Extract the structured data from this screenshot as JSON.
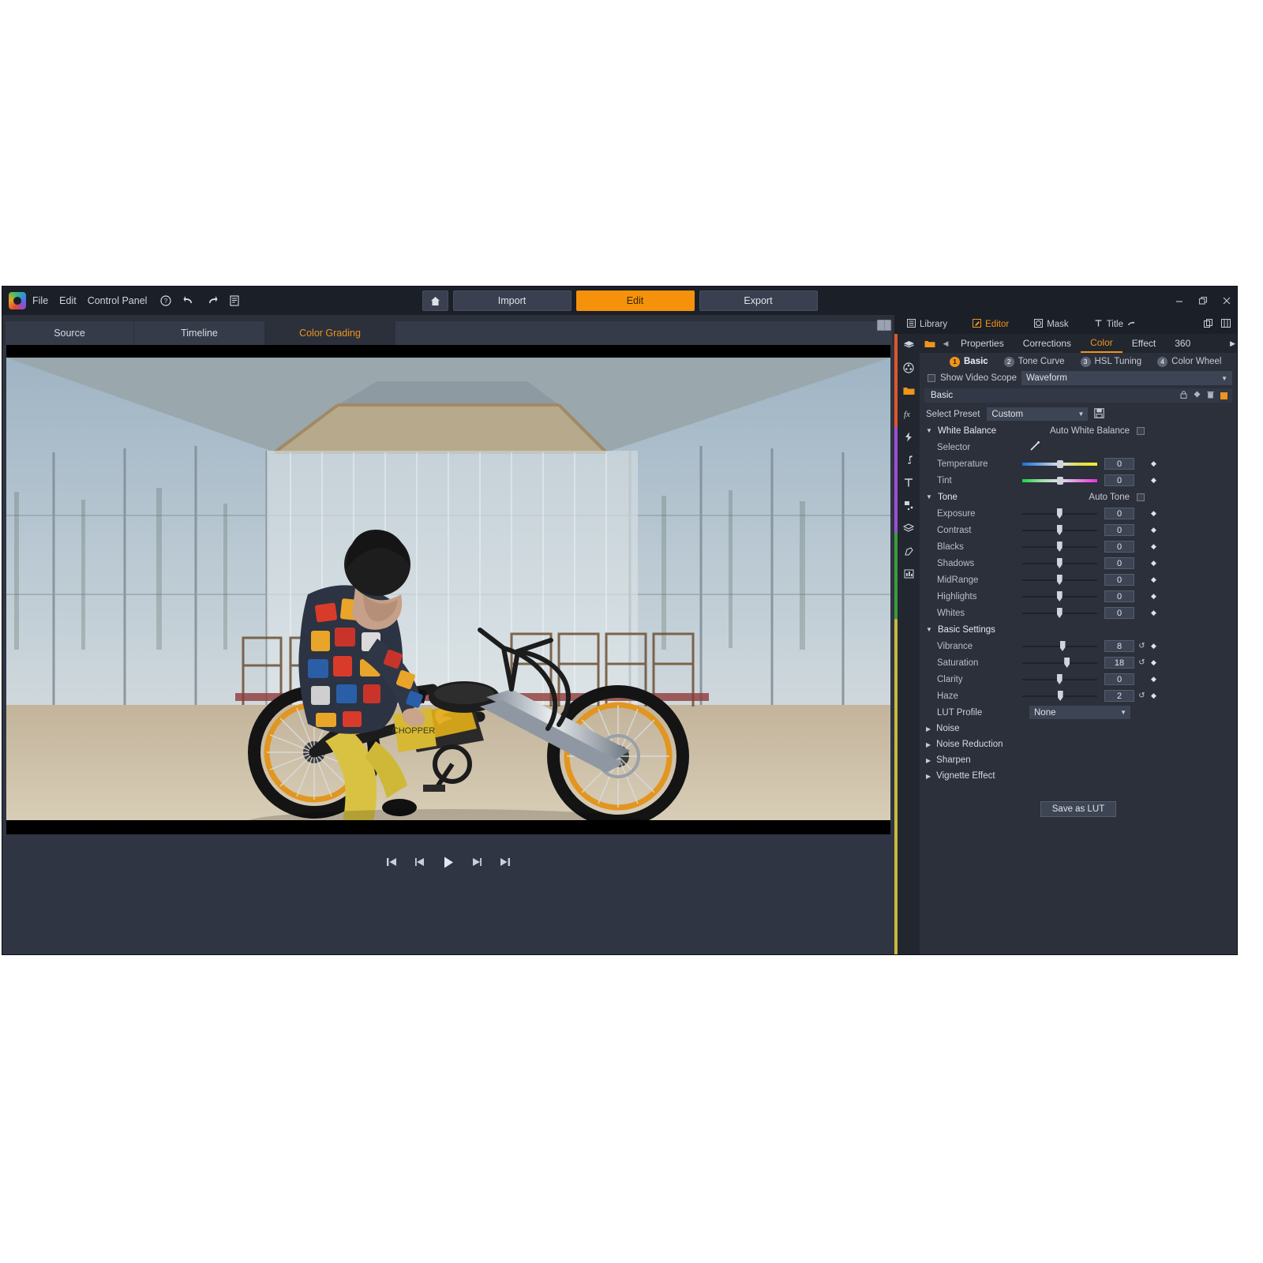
{
  "window": {
    "menu": [
      "File",
      "Edit",
      "Control Panel"
    ],
    "toolbar_icons": [
      "help-icon",
      "undo-icon",
      "redo-icon",
      "document-icon"
    ],
    "controls": [
      "minimize",
      "restore",
      "close"
    ],
    "mode_buttons": [
      {
        "label": "Import",
        "active": false
      },
      {
        "label": "Edit",
        "active": true
      },
      {
        "label": "Export",
        "active": false
      }
    ],
    "home_icon": "home-icon"
  },
  "preview": {
    "tabs": [
      "Source",
      "Timeline",
      "Color Grading"
    ],
    "active_tab": "Color Grading",
    "transport": [
      "skip-to-start",
      "step-back",
      "play",
      "step-forward",
      "skip-to-end"
    ]
  },
  "right_panel": {
    "top_tabs": [
      {
        "label": "Library",
        "icon": "library-icon",
        "active": false
      },
      {
        "label": "Editor",
        "icon": "editor-pencil-icon",
        "active": true
      },
      {
        "label": "Mask",
        "icon": "mask-icon",
        "active": false
      },
      {
        "label": "Title",
        "icon": "title-T-icon",
        "active": false
      }
    ],
    "mode_tabs": [
      {
        "label": "Properties",
        "active": false
      },
      {
        "label": "Corrections",
        "active": false
      },
      {
        "label": "Color",
        "active": true
      },
      {
        "label": "Effect",
        "active": false
      },
      {
        "label": "360",
        "active": false
      }
    ],
    "numbered_tabs": [
      {
        "num": "1",
        "label": "Basic",
        "active": true
      },
      {
        "num": "2",
        "label": "Tone Curve",
        "active": false
      },
      {
        "num": "3",
        "label": "HSL Tuning",
        "active": false
      },
      {
        "num": "4",
        "label": "Color Wheel",
        "active": false
      }
    ],
    "video_scope": {
      "checkbox_label": "Show Video Scope",
      "checked": false,
      "selected": "Waveform"
    },
    "section_title": "Basic",
    "section_actions": [
      "lock-icon",
      "keyframe-icon",
      "trash-icon",
      "color-swatch-icon"
    ],
    "preset": {
      "label": "Select Preset",
      "value": "Custom",
      "save_icon": "floppy-save-icon"
    },
    "groups": [
      {
        "name": "White Balance",
        "expanded": true,
        "auto_label": "Auto White Balance",
        "auto_checked": false,
        "rows": [
          {
            "label": "Selector",
            "type": "picker",
            "icon": "eyedropper-icon"
          },
          {
            "label": "Temperature",
            "type": "slider",
            "value": "0",
            "track": "temp",
            "pos": 46,
            "reset": false
          },
          {
            "label": "Tint",
            "type": "slider",
            "value": "0",
            "track": "tint",
            "pos": 46,
            "reset": false
          }
        ]
      },
      {
        "name": "Tone",
        "expanded": true,
        "auto_label": "Auto Tone",
        "auto_checked": false,
        "rows": [
          {
            "label": "Exposure",
            "type": "slider",
            "value": "0",
            "track": "plain",
            "pos": 46,
            "reset": false
          },
          {
            "label": "Contrast",
            "type": "slider",
            "value": "0",
            "track": "plain",
            "pos": 46,
            "reset": false
          },
          {
            "label": "Blacks",
            "type": "slider",
            "value": "0",
            "track": "plain",
            "pos": 46,
            "reset": false
          },
          {
            "label": "Shadows",
            "type": "slider",
            "value": "0",
            "track": "plain",
            "pos": 46,
            "reset": false
          },
          {
            "label": "MidRange",
            "type": "slider",
            "value": "0",
            "track": "plain",
            "pos": 46,
            "reset": false
          },
          {
            "label": "Highlights",
            "type": "slider",
            "value": "0",
            "track": "plain",
            "pos": 46,
            "reset": false
          },
          {
            "label": "Whites",
            "type": "slider",
            "value": "0",
            "track": "plain",
            "pos": 46,
            "reset": false
          }
        ]
      },
      {
        "name": "Basic Settings",
        "expanded": true,
        "auto_label": "",
        "auto_checked": false,
        "rows": [
          {
            "label": "Vibrance",
            "type": "slider",
            "value": "8",
            "track": "plain",
            "pos": 50,
            "reset": true
          },
          {
            "label": "Saturation",
            "type": "slider",
            "value": "18",
            "track": "plain",
            "pos": 56,
            "reset": true
          },
          {
            "label": "Clarity",
            "type": "slider",
            "value": "0",
            "track": "plain",
            "pos": 46,
            "reset": false
          },
          {
            "label": "Haze",
            "type": "slider",
            "value": "2",
            "track": "plain",
            "pos": 47,
            "reset": true
          },
          {
            "label": "LUT Profile",
            "type": "dropdown",
            "value": "None"
          }
        ]
      }
    ],
    "collapsed_sections": [
      "Noise",
      "Noise Reduction",
      "Sharpen",
      "Vignette Effect"
    ],
    "save_lut_label": "Save as LUT"
  },
  "colors": {
    "accent": "#f0941c",
    "panel": "#2b303b",
    "dark": "#1b1f27",
    "field": "#3d4453"
  }
}
